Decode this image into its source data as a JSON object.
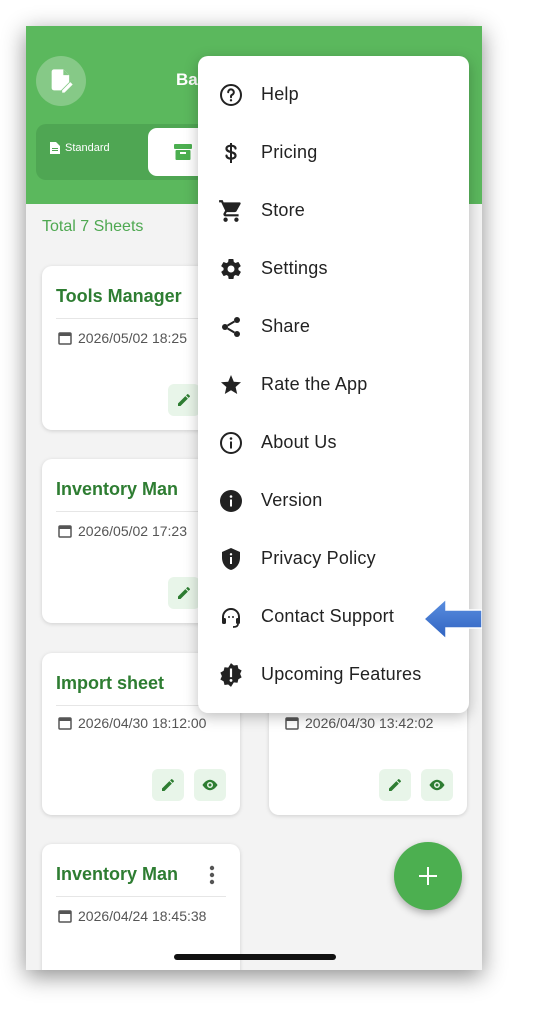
{
  "app": {
    "title": "Ba"
  },
  "tabs": [
    {
      "label": "Standard",
      "icon": "document-icon"
    },
    {
      "label": "",
      "icon": "archive-icon"
    }
  ],
  "summary": {
    "total": "Total 7 Sheets"
  },
  "cards": [
    {
      "title": "Tools Manager",
      "date": "2026/05/02 18:25"
    },
    {
      "title": "Inventory Man",
      "date": "2026/05/02 17:23"
    },
    {
      "title": "Import sheet",
      "date": "2026/04/30 18:12:00"
    },
    {
      "title": "",
      "date": "2026/04/30 13:42:02"
    },
    {
      "title": "Inventory Man",
      "date": "2026/04/24 18:45:38"
    }
  ],
  "menu": {
    "items": [
      {
        "label": "Help",
        "icon": "help-circle-icon"
      },
      {
        "label": "Pricing",
        "icon": "dollar-icon"
      },
      {
        "label": "Store",
        "icon": "cart-icon"
      },
      {
        "label": "Settings",
        "icon": "gear-icon"
      },
      {
        "label": "Share",
        "icon": "share-icon"
      },
      {
        "label": "Rate the App",
        "icon": "star-icon"
      },
      {
        "label": "About Us",
        "icon": "info-outline-icon"
      },
      {
        "label": "Version",
        "icon": "info-filled-icon"
      },
      {
        "label": "Privacy Policy",
        "icon": "shield-icon"
      },
      {
        "label": "Contact Support",
        "icon": "headset-icon"
      },
      {
        "label": "Upcoming Features",
        "icon": "alert-badge-icon"
      }
    ]
  },
  "colors": {
    "primary": "#5bb85d",
    "accent_text": "#2e7d32",
    "fab": "#4caf50",
    "arrow": "#3b6fc9"
  }
}
